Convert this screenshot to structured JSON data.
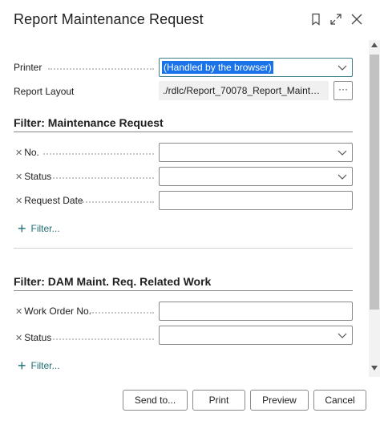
{
  "dialog": {
    "title": "Report Maintenance Request",
    "icons": {
      "pin": "bookmark-icon",
      "expand": "expand-icon",
      "close": "close-icon"
    }
  },
  "options": {
    "printer": {
      "label": "Printer",
      "value": "(Handled by the browser)"
    },
    "report_layout": {
      "label": "Report Layout",
      "value": "./rdlc/Report_70078_Report_Maintenan...",
      "button": "···"
    }
  },
  "filter_request": {
    "title": "Filter: Maintenance Request",
    "fields": [
      {
        "label": "No.",
        "value": ""
      },
      {
        "label": "Status",
        "value": ""
      },
      {
        "label": "Request Date",
        "value": ""
      }
    ],
    "add_filter": "Filter..."
  },
  "filter_work": {
    "title": "Filter: DAM Maint. Req. Related Work",
    "fields": [
      {
        "label": "Work Order No.",
        "value": ""
      },
      {
        "label": "Status",
        "value": ""
      }
    ],
    "add_filter": "Filter..."
  },
  "footer": {
    "send_to": "Send to...",
    "print": "Print",
    "preview": "Preview",
    "cancel": "Cancel"
  },
  "colors": {
    "accent": "#1f6e76",
    "highlight": "#1a73e8"
  }
}
